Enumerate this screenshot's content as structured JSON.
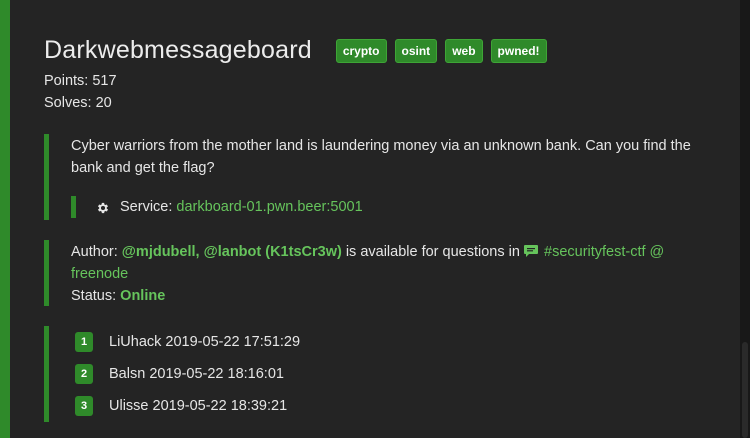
{
  "challenge": {
    "title": "Darkwebmessageboard",
    "tags": [
      "crypto",
      "osint",
      "web",
      "pwned!"
    ],
    "points_label": "Points: 517",
    "solves_label": "Solves: 20",
    "description": "Cyber warriors from the mother land is laundering money via an unknown bank. Can you find the bank and get the flag?",
    "service_label": "Service:",
    "service_link": "darkboard-01.pwn.beer:5001"
  },
  "author": {
    "prefix": "Author:",
    "names": "@mjdubell, @lanbot (K1tsCr3w)",
    "middle": "is available for questions in",
    "channel": "#securityfest-ctf @ freenode",
    "status_label": "Status:",
    "status_value": "Online"
  },
  "solves": [
    {
      "rank": "1",
      "team": "LiUhack",
      "time": "2019-05-22 17:51:29"
    },
    {
      "rank": "2",
      "team": "Balsn",
      "time": "2019-05-22 18:16:01"
    },
    {
      "rank": "3",
      "team": "Ulisse",
      "time": "2019-05-22 18:39:21"
    }
  ],
  "colors": {
    "accent": "#2f8a2a",
    "link": "#66c45c",
    "background": "#242424"
  },
  "icons": {
    "service": "gear-icon",
    "channel": "chat-icon"
  }
}
